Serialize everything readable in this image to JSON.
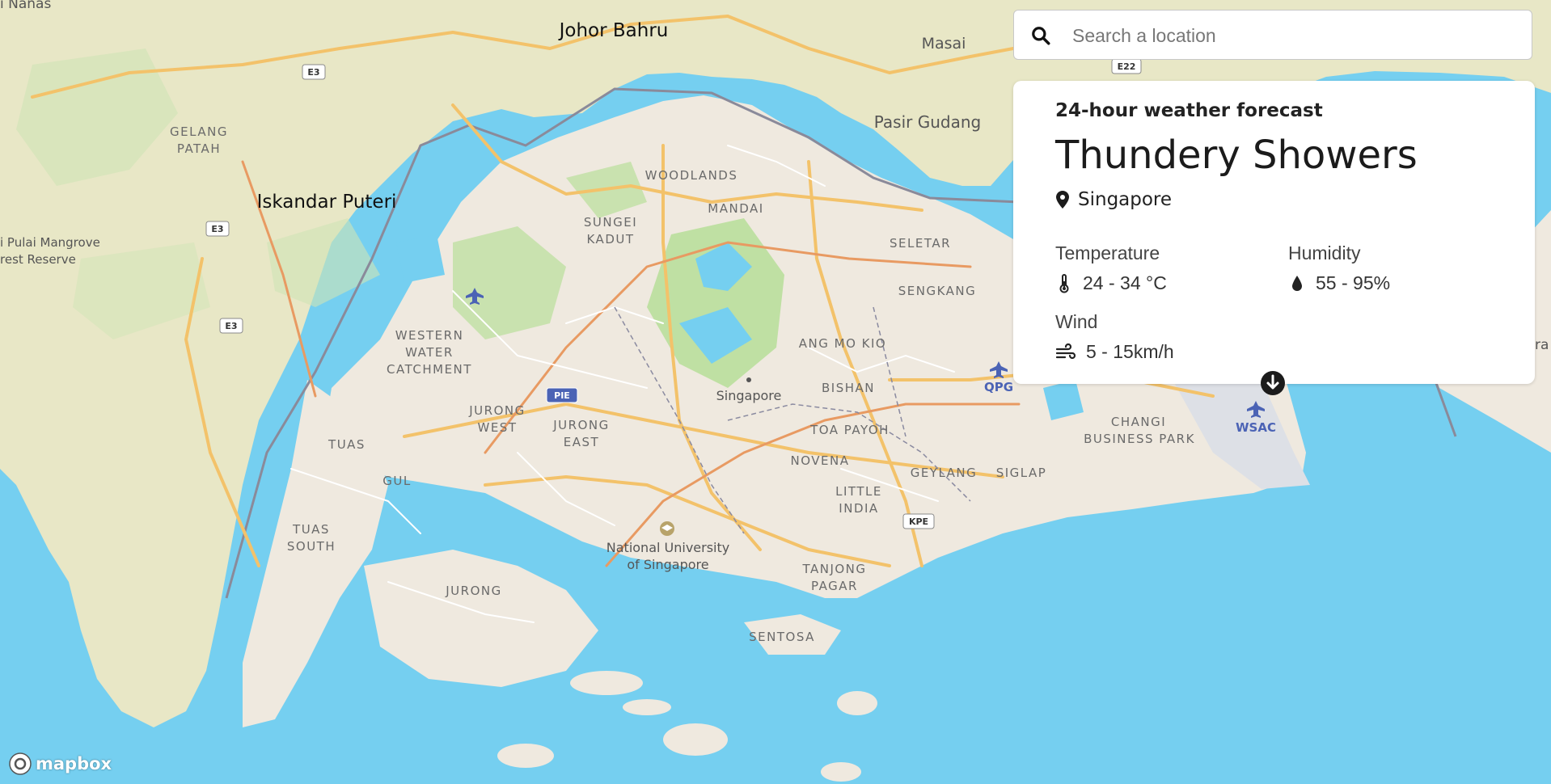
{
  "search": {
    "placeholder": "Search a location"
  },
  "forecast": {
    "subtitle": "24-hour weather forecast",
    "condition": "Thundery Showers",
    "location": "Singapore",
    "temperature": {
      "label": "Temperature",
      "value": "24 - 34 °C"
    },
    "humidity": {
      "label": "Humidity",
      "value": "55 - 95%"
    },
    "wind": {
      "label": "Wind",
      "value": "5 - 15km/h"
    }
  },
  "map": {
    "cities": [
      "Johor Bahru",
      "Iskandar Puteri"
    ],
    "places": [
      "Masai",
      "Pasir Gudang",
      "Singapore",
      "National University",
      "of Singapore",
      "i Nanas",
      "i Pulai Mangrove",
      "rest Reserve",
      "ra"
    ],
    "districts": [
      "WOODLANDS",
      "MANDAI",
      "SUNGEI",
      "KADUT",
      "SELETAR",
      "SENGKANG",
      "GELANG",
      "PATAH",
      "WESTERN",
      "WATER",
      "CATCHMENT",
      "ANG MO KIO",
      "BISHAN",
      "TOA PAYOH",
      "NOVENA",
      "JURONG",
      "WEST",
      "EAST",
      "TUAS",
      "GUL",
      "SOUTH",
      "LITTLE",
      "INDIA",
      "GEYLANG",
      "SIGLAP",
      "CHANGI",
      "BUSINESS PARK",
      "TANJONG",
      "PAGAR",
      "SENTOSA"
    ],
    "road_shields": [
      "E3",
      "E22",
      "PIE",
      "KPE"
    ],
    "airports": [
      "QPG",
      "WSAC"
    ],
    "attribution": "mapbox"
  },
  "colors": {
    "water": "#75cff0",
    "land": "#efe9df",
    "park": "#cde8b5",
    "major_road": "#f3c26a",
    "accent": "#4b63b5"
  },
  "icons": {
    "search": "search-icon",
    "location": "map-pin-icon",
    "temperature": "thermometer-icon",
    "humidity": "droplet-icon",
    "wind": "wind-icon",
    "marker": "arrow-down-marker-icon"
  }
}
